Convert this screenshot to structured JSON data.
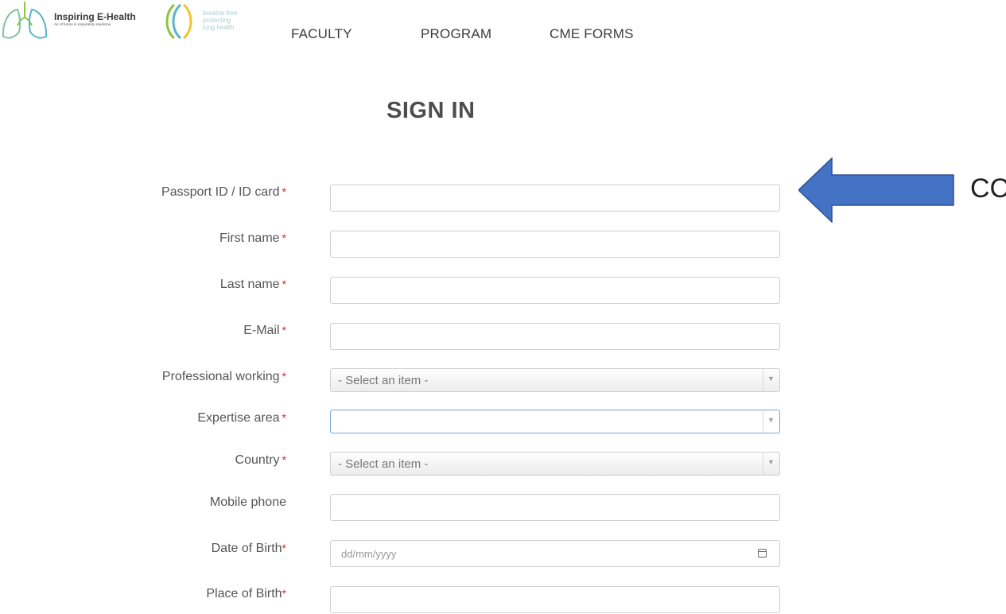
{
  "header": {
    "brand_name": "Inspiring E-Health",
    "brand_tagline": "Air of future in respiratory medicine",
    "partner_text": [
      "breathe free",
      "protecting",
      "lung health"
    ],
    "nav": [
      "FACULTY",
      "PROGRAM",
      "CME FORMS"
    ]
  },
  "page_title": "SIGN IN",
  "form": {
    "required_mark": "*",
    "fields": [
      {
        "label": "Passport ID / ID card",
        "required": true,
        "type": "text"
      },
      {
        "label": "First name",
        "required": true,
        "type": "text"
      },
      {
        "label": "Last name",
        "required": true,
        "type": "text"
      },
      {
        "label": "E-Mail",
        "required": true,
        "type": "text"
      },
      {
        "label": "Professional working",
        "required": true,
        "type": "select",
        "value": "- Select an item -"
      },
      {
        "label": "Expertise area",
        "required": true,
        "type": "select",
        "value": ""
      },
      {
        "label": "Country",
        "required": true,
        "type": "select",
        "value": "- Select an item -"
      },
      {
        "label": "Mobile phone",
        "required": false,
        "type": "text"
      },
      {
        "label": "Date of Birth",
        "required": true,
        "type": "date",
        "placeholder": "dd/mm/yyyy"
      },
      {
        "label": "Place of Birth",
        "required": true,
        "type": "text"
      }
    ]
  },
  "annotation": {
    "label": "CC",
    "color": "#4472c4"
  },
  "colors": {
    "required": "#d9232d",
    "title": "#4d4d4d",
    "logo_green": "#8cc63f",
    "logo_teal": "#5bb5c6"
  }
}
